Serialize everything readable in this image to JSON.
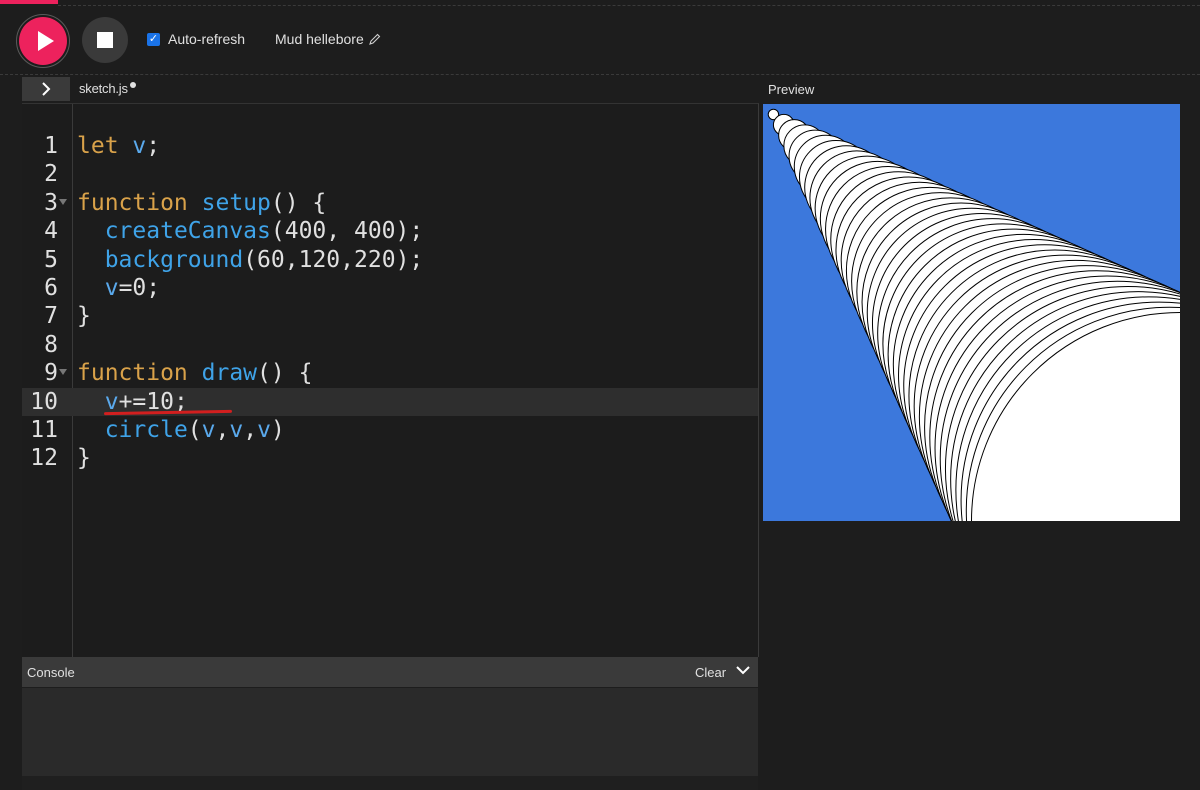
{
  "toolbar": {
    "auto_refresh_label": "Auto-refresh",
    "auto_refresh_checked": true,
    "sketch_name": "Mud hellebore"
  },
  "editor": {
    "file_tab": "sketch.js",
    "unsaved": true,
    "highlighted_line": 10,
    "lines": [
      {
        "num": "1",
        "code": "let v;"
      },
      {
        "num": "2",
        "code": ""
      },
      {
        "num": "3",
        "code": "function setup() {"
      },
      {
        "num": "4",
        "code": "  createCanvas(400, 400);"
      },
      {
        "num": "5",
        "code": "  background(60,120,220);"
      },
      {
        "num": "6",
        "code": "  v=0;"
      },
      {
        "num": "7",
        "code": "}"
      },
      {
        "num": "8",
        "code": ""
      },
      {
        "num": "9",
        "code": "function draw() {"
      },
      {
        "num": "10",
        "code": "  v+=10;"
      },
      {
        "num": "11",
        "code": "  circle(v,v,v)"
      },
      {
        "num": "12",
        "code": "}"
      }
    ]
  },
  "preview": {
    "label": "Preview",
    "background": "#3c78dc"
  },
  "console": {
    "title": "Console",
    "clear_label": "Clear"
  }
}
